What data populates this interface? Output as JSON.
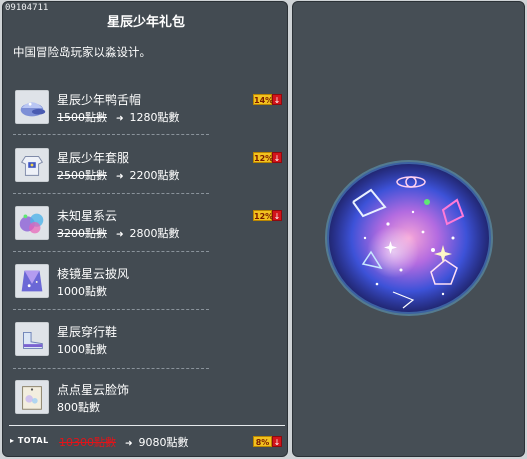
{
  "code": "09104711",
  "title": "星辰少年礼包",
  "description": "中国冒险岛玩家以淼设计。",
  "items": [
    {
      "name": "星辰少年鸭舌帽",
      "old_price": "1500點數",
      "new_price": "1280點數",
      "discount": "14%",
      "icon": "star-cap-icon"
    },
    {
      "name": "星辰少年套服",
      "old_price": "2500點數",
      "new_price": "2200點數",
      "discount": "12%",
      "icon": "star-outfit-icon"
    },
    {
      "name": "未知星系云",
      "old_price": "3200點數",
      "new_price": "2800點數",
      "discount": "12%",
      "icon": "galaxy-cloud-icon"
    },
    {
      "name": "棱镜星云披风",
      "price": "1000點數",
      "icon": "nebula-cape-icon"
    },
    {
      "name": "星辰穿行鞋",
      "price": "1000點數",
      "icon": "star-shoes-icon"
    },
    {
      "name": "点点星云脸饰",
      "price": "800點數",
      "icon": "nebula-face-icon"
    }
  ],
  "total": {
    "label": "TOTAL",
    "old_price": "10300點數",
    "new_price": "9080點數",
    "discount": "8%"
  },
  "preview": {
    "icon": "galaxy-orb-icon"
  },
  "colors": {
    "panel": "#434b52",
    "badge": "#f2c21f",
    "down": "#d3141b",
    "strike_total": "#e0141a"
  }
}
